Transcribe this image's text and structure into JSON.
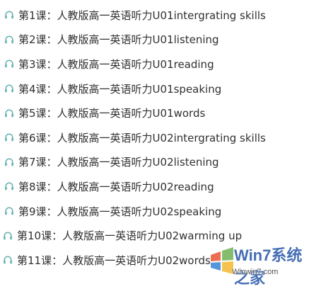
{
  "lessons": [
    {
      "lesson": "第1课：",
      "title": "人教版高一英语听力U01intergrating skills"
    },
    {
      "lesson": "第2课：",
      "title": "人教版高一英语听力U01listening"
    },
    {
      "lesson": "第3课：",
      "title": "人教版高一英语听力U01reading"
    },
    {
      "lesson": "第4课：",
      "title": "人教版高一英语听力U01speaking"
    },
    {
      "lesson": "第5课：",
      "title": "人教版高一英语听力U01words"
    },
    {
      "lesson": "第6课：",
      "title": "人教版高一英语听力U02intergrating skills"
    },
    {
      "lesson": "第7课：",
      "title": "人教版高一英语听力U02listening"
    },
    {
      "lesson": "第8课：",
      "title": "人教版高一英语听力U02reading"
    },
    {
      "lesson": "第9课：",
      "title": "人教版高一英语听力U02speaking"
    },
    {
      "lesson": "第10课：",
      "title": "人教版高一英语听力U02warming up"
    },
    {
      "lesson": "第11课：",
      "title": "人教版高一英语听力U02words"
    }
  ],
  "icons": {
    "item_icon": "headphone-icon"
  },
  "watermark": {
    "brand": "Win7系统之家",
    "url": "Winwin7.com"
  },
  "colors": {
    "text": "#303030",
    "icon": "#62b0b1",
    "watermark_blue": "#1d4fa6"
  }
}
